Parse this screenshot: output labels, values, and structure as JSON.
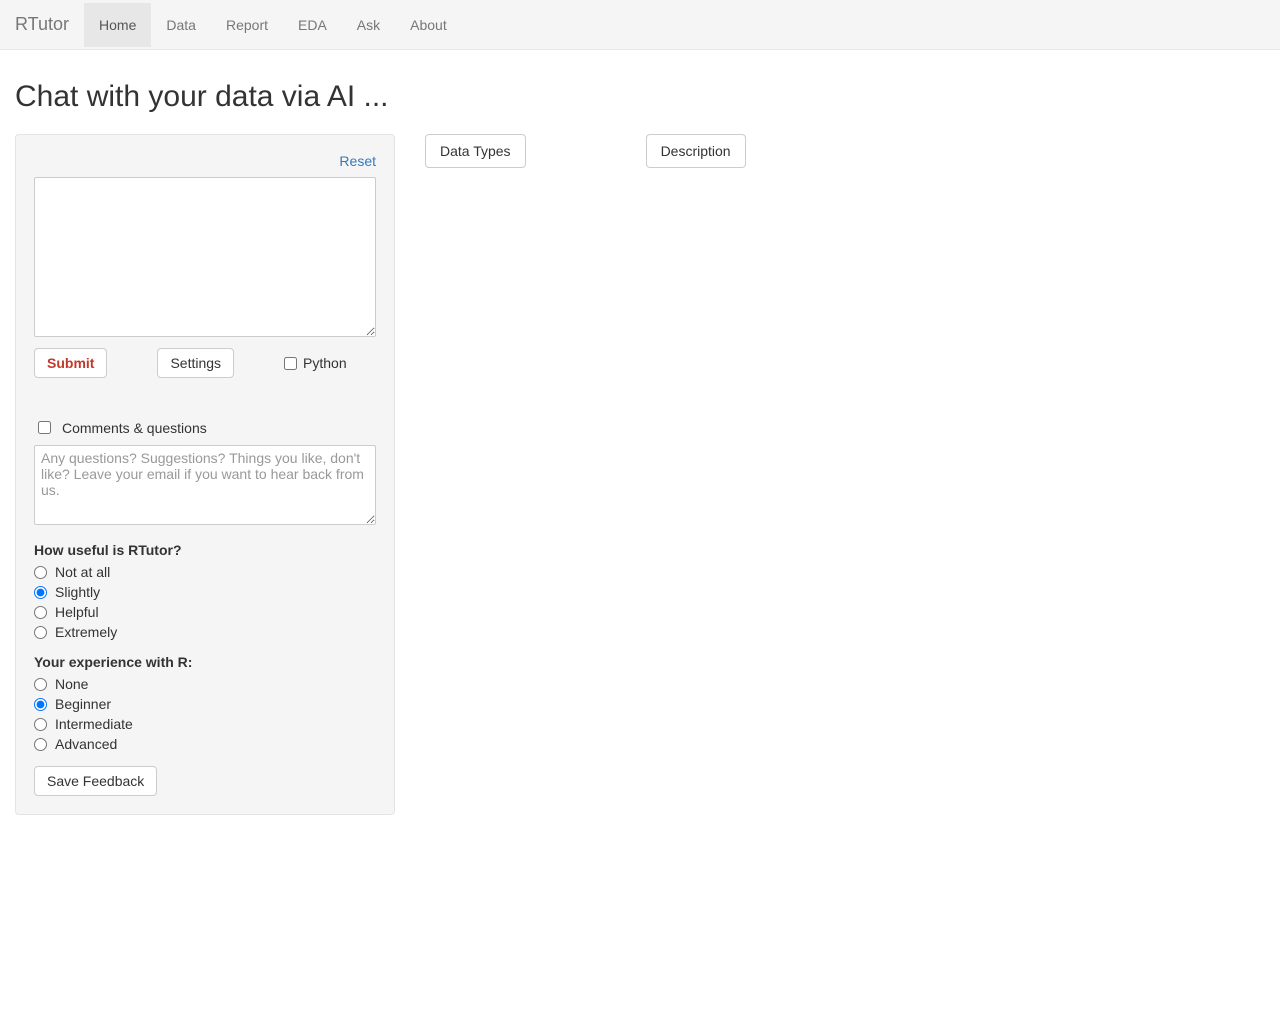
{
  "navbar": {
    "brand": "RTutor",
    "tabs": [
      {
        "label": "Home",
        "active": true
      },
      {
        "label": "Data",
        "active": false
      },
      {
        "label": "Report",
        "active": false
      },
      {
        "label": "EDA",
        "active": false
      },
      {
        "label": "Ask",
        "active": false
      },
      {
        "label": "About",
        "active": false
      }
    ]
  },
  "page": {
    "title": "Chat with your data via AI ..."
  },
  "sidebar": {
    "reset_label": "Reset",
    "chat_value": "",
    "submit_label": "Submit",
    "settings_label": "Settings",
    "python_label": "Python",
    "python_checked": false,
    "comments_checkbox_label": "Comments & questions",
    "comments_checked": false,
    "comments_placeholder": "Any questions? Suggestions? Things you like, don't like? Leave your email if you want to hear back from us.",
    "comments_value": "",
    "useful_question": "How useful is RTutor?",
    "useful_options": [
      {
        "label": "Not at all",
        "checked": false
      },
      {
        "label": "Slightly",
        "checked": true
      },
      {
        "label": "Helpful",
        "checked": false
      },
      {
        "label": "Extremely",
        "checked": false
      }
    ],
    "experience_question": "Your experience with R:",
    "experience_options": [
      {
        "label": "None",
        "checked": false
      },
      {
        "label": "Beginner",
        "checked": true
      },
      {
        "label": "Intermediate",
        "checked": false
      },
      {
        "label": "Advanced",
        "checked": false
      }
    ],
    "save_feedback_label": "Save Feedback"
  },
  "main": {
    "data_types_label": "Data Types",
    "description_label": "Description"
  }
}
